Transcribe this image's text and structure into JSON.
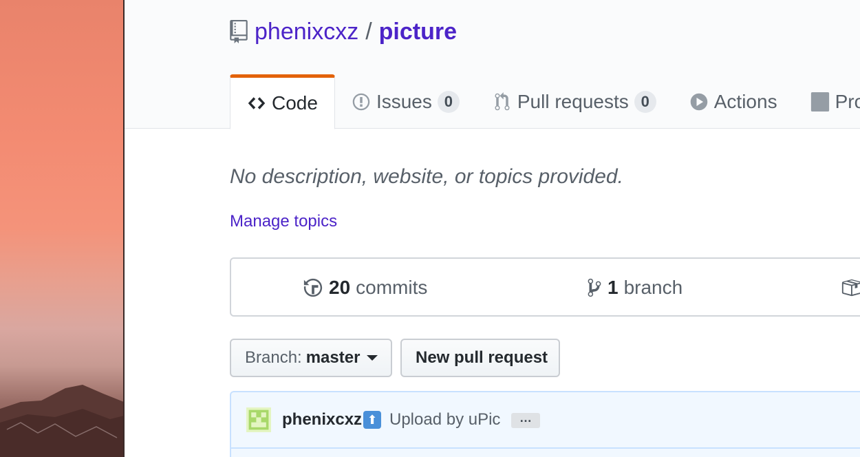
{
  "repo": {
    "owner": "phenixcxz",
    "separator": "/",
    "name": "picture"
  },
  "tabs": [
    {
      "label": "Code",
      "icon": "code-icon",
      "selected": true
    },
    {
      "label": "Issues",
      "icon": "issue-icon",
      "count": "0"
    },
    {
      "label": "Pull requests",
      "icon": "pull-request-icon",
      "count": "0"
    },
    {
      "label": "Actions",
      "icon": "play-icon"
    },
    {
      "label": "Pro",
      "icon": "project-icon"
    }
  ],
  "description": "No description, website, or topics provided.",
  "manage_topics": "Manage topics",
  "numbers": {
    "commits_count": "20",
    "commits_label": "commits",
    "branch_count": "1",
    "branch_label": "branch"
  },
  "branch_select": {
    "label": "Branch:",
    "value": "master"
  },
  "new_pr_button": "New pull request",
  "latest_commit": {
    "author": "phenixcxz",
    "emoji": "⬆",
    "message": "Upload by uPic",
    "ellipsis": "…"
  },
  "colors": {
    "link": "#4c24c8",
    "tab_accent": "#e36209",
    "commit_bar_bg": "#f1f8ff"
  }
}
